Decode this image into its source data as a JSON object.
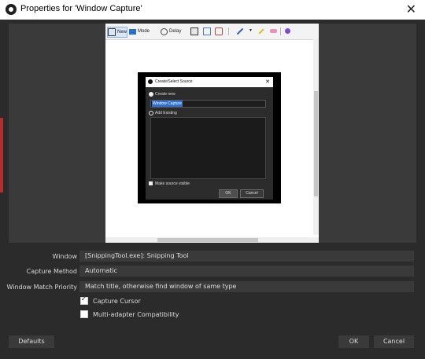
{
  "window": {
    "title": "Properties for 'Window Capture'",
    "close_glyph": "✕"
  },
  "preview": {
    "toolbar": {
      "new_label": "New",
      "mode_label": "Mode",
      "delay_label": "Delay"
    },
    "nested_dialog": {
      "title": "Create/Select Source",
      "close_glyph": "✕",
      "create_new_label": "Create new",
      "name_value": "Window Capture",
      "add_existing_label": "Add Existing",
      "make_visible_label": "Make source visible",
      "ok_label": "OK",
      "cancel_label": "Cancel"
    }
  },
  "form": {
    "window_label": "Window",
    "window_value": "[SnippingTool.exe]: Snipping Tool",
    "capture_method_label": "Capture Method",
    "capture_method_value": "Automatic",
    "match_priority_label": "Window Match Priority",
    "match_priority_value": "Match title, otherwise find window of same type",
    "capture_cursor_label": "Capture Cursor",
    "capture_cursor_checked": true,
    "multi_adapter_label": "Multi-adapter Compatibility",
    "multi_adapter_checked": false
  },
  "buttons": {
    "defaults": "Defaults",
    "ok": "OK",
    "cancel": "Cancel"
  },
  "colors": {
    "background": "#2b2b2b",
    "field": "#3a3a3a",
    "text": "#dddddd",
    "accent": "#2e6fcf"
  }
}
